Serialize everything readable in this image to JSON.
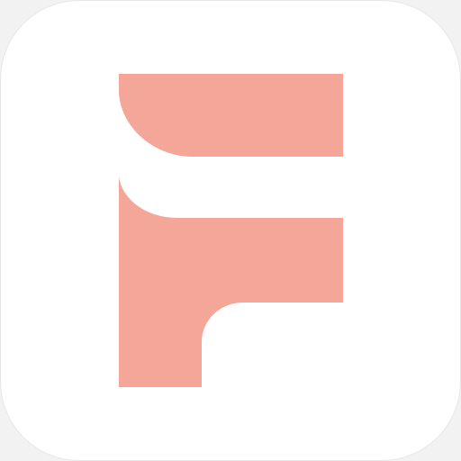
{
  "app_icon": {
    "icon_name": "letter-f-logo-icon",
    "background_color": "#ffffff",
    "accent_color": "#f4a699"
  }
}
